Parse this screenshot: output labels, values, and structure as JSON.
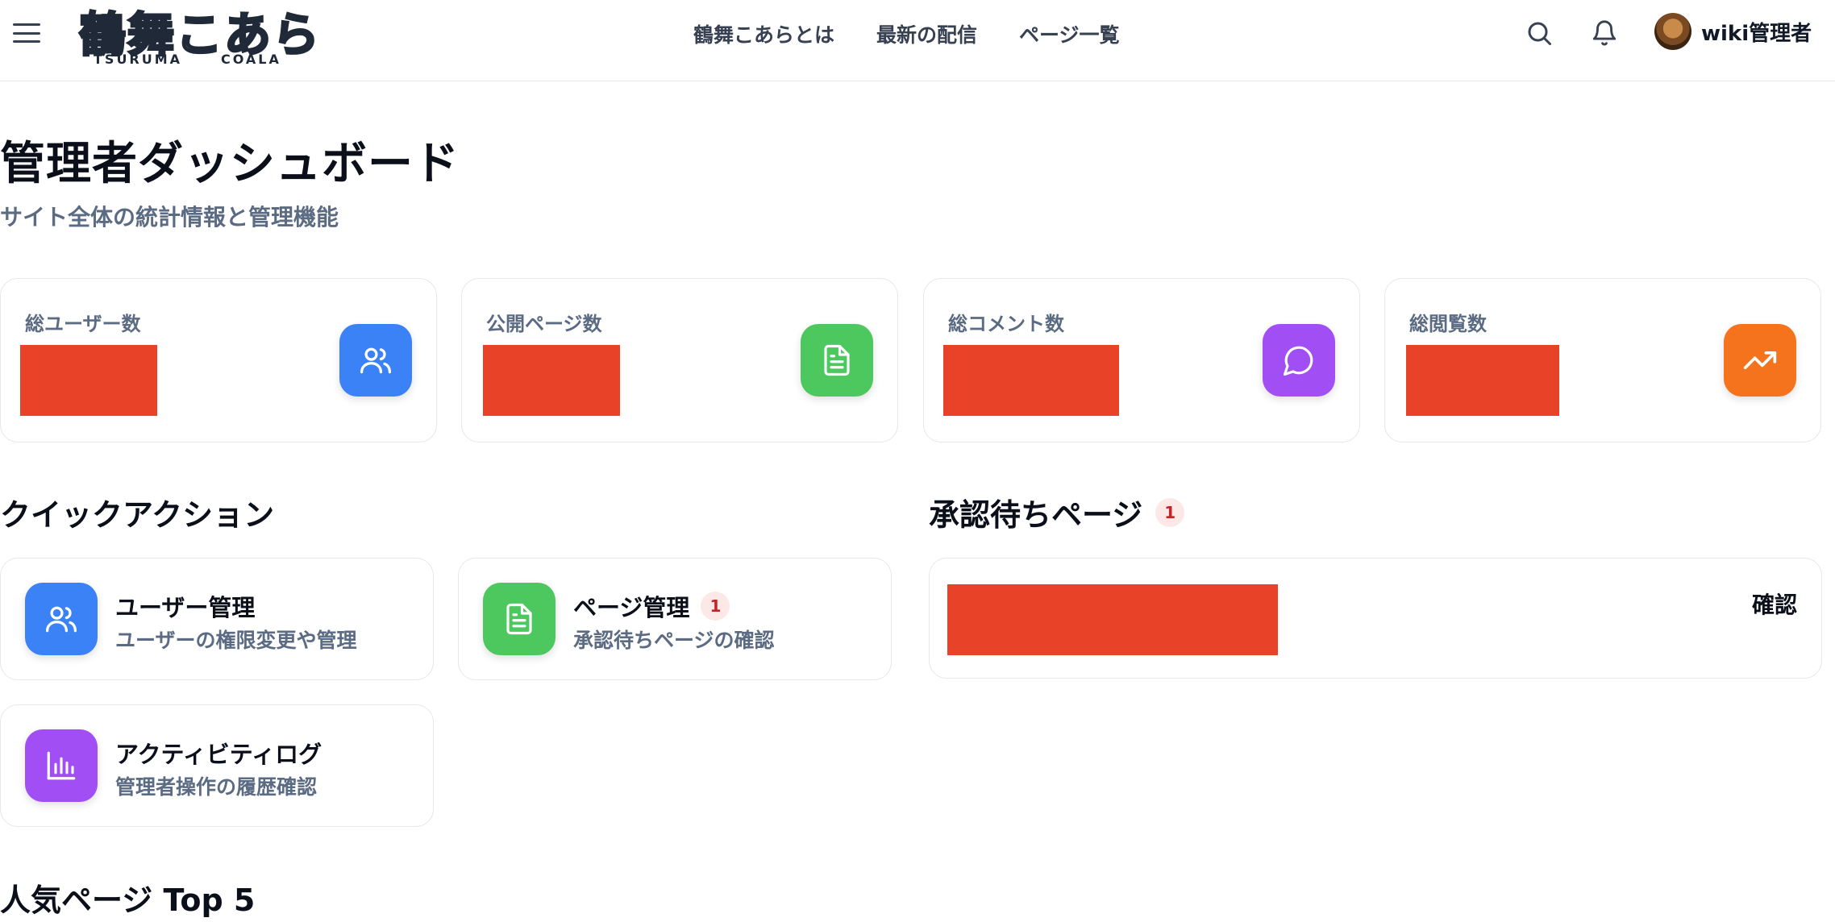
{
  "header": {
    "menu_icon": "hamburger-icon",
    "logo": {
      "main": "鶴舞こあら",
      "sub_left": "TSURUMA",
      "sub_right": "COALA"
    },
    "nav": [
      {
        "label": "鶴舞こあらとは"
      },
      {
        "label": "最新の配信"
      },
      {
        "label": "ページ一覧"
      }
    ],
    "search_icon": "search-icon",
    "notification_icon": "bell-icon",
    "user": {
      "name": "wiki管理者"
    }
  },
  "page": {
    "title": "管理者ダッシュボード",
    "subtitle": "サイト全体の統計情報と管理機能"
  },
  "stats": [
    {
      "label": "総ユーザー数",
      "value": "",
      "icon": "users-icon",
      "color": "#3b82f6"
    },
    {
      "label": "公開ページ数",
      "value": "",
      "icon": "document-icon",
      "color": "#4cc85f"
    },
    {
      "label": "総コメント数",
      "value": "",
      "icon": "chat-bubble-icon",
      "color": "#a14ef5"
    },
    {
      "label": "総閲覧数",
      "value": "",
      "icon": "trending-up-icon",
      "color": "#f4731c"
    }
  ],
  "quick_actions": {
    "title": "クイックアクション",
    "items": [
      {
        "title": "ユーザー管理",
        "description": "ユーザーの権限変更や管理",
        "icon": "users-icon",
        "color": "#3b82f6"
      },
      {
        "title": "ページ管理",
        "description": "承認待ちページの確認",
        "badge": "1",
        "icon": "document-icon",
        "color": "#4cc85f"
      },
      {
        "title": "アクティビティログ",
        "description": "管理者操作の履歴確認",
        "icon": "bar-chart-icon",
        "color": "#a14ef5"
      }
    ]
  },
  "pending": {
    "title": "承認待ちページ",
    "count": "1",
    "items": [
      {
        "name": "",
        "action": "確認"
      }
    ]
  },
  "popular": {
    "title": "人気ページ Top 5"
  },
  "redaction_color": "#e84328"
}
